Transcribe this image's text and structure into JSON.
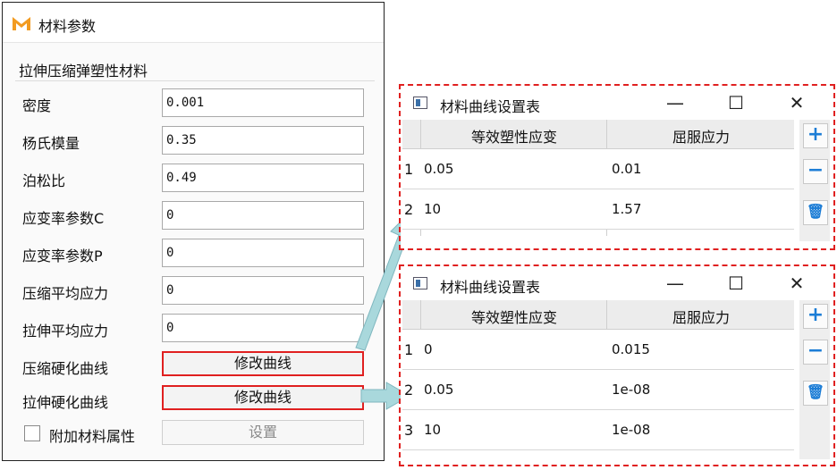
{
  "panel": {
    "title": "材料参数",
    "group_label": "拉伸压缩弹塑性材料",
    "rows": [
      {
        "label": "密度",
        "value": "0.001"
      },
      {
        "label": "杨氏模量",
        "value": "0.35"
      },
      {
        "label": "泊松比",
        "value": "0.49"
      },
      {
        "label": "应变率参数C",
        "value": "0"
      },
      {
        "label": "应变率参数P",
        "value": "0"
      },
      {
        "label": "压缩平均应力",
        "value": "0"
      },
      {
        "label": "拉伸平均应力",
        "value": "0"
      }
    ],
    "compress_curve": {
      "label": "压缩硬化曲线",
      "button": "修改曲线"
    },
    "tension_curve": {
      "label": "拉伸硬化曲线",
      "button": "修改曲线"
    },
    "extra": {
      "label": "附加材料属性",
      "button": "设置",
      "checked": false
    }
  },
  "dialogs": [
    {
      "title": "材料曲线设置表",
      "columns": [
        "等效塑性应变",
        "屈服应力"
      ],
      "rows": [
        {
          "index": "1",
          "strain": "0.05",
          "stress": "0.01"
        },
        {
          "index": "2",
          "strain": "10",
          "stress": "1.57"
        }
      ]
    },
    {
      "title": "材料曲线设置表",
      "columns": [
        "等效塑性应变",
        "屈服应力"
      ],
      "rows": [
        {
          "index": "1",
          "strain": "0",
          "stress": "0.015"
        },
        {
          "index": "2",
          "strain": "0.05",
          "stress": "1e-08"
        },
        {
          "index": "3",
          "strain": "10",
          "stress": "1e-08"
        }
      ]
    }
  ],
  "window_controls": {
    "minimize": "—",
    "maximize": "☐",
    "close": "✕"
  },
  "side_buttons": {
    "add": "+",
    "remove": "−",
    "delete": "🗑"
  },
  "colors": {
    "highlight": "#e02020",
    "arrow": "#a9d8dc",
    "accent": "#1c7dd6",
    "logo": "#f29b21"
  }
}
